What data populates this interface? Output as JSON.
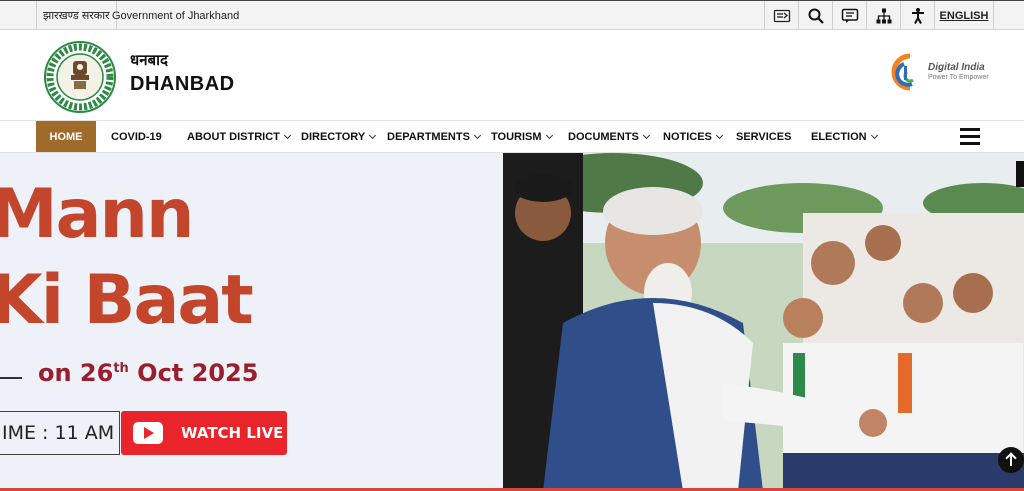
{
  "topbar": {
    "hindi_gov": "झारखण्ड सरकार",
    "english_gov": "Government of Jharkhand",
    "language": "ENGLISH",
    "tools": [
      "skip-to-content-icon",
      "search-icon",
      "screen-reader-icon",
      "sitemap-icon",
      "accessibility-icon"
    ]
  },
  "header": {
    "site_name_hindi": "धनबाद",
    "site_name": "DHANBAD",
    "digital_india_title": "Digital India",
    "digital_india_tagline": "Power To Empower"
  },
  "nav": {
    "items": [
      {
        "label": "HOME",
        "dropdown": false
      },
      {
        "label": "COVID-19",
        "dropdown": false
      },
      {
        "label": "ABOUT DISTRICT",
        "dropdown": true
      },
      {
        "label": "DIRECTORY",
        "dropdown": true
      },
      {
        "label": "DEPARTMENTS",
        "dropdown": true
      },
      {
        "label": "TOURISM",
        "dropdown": true
      },
      {
        "label": "DOCUMENTS",
        "dropdown": true
      },
      {
        "label": "NOTICES",
        "dropdown": true
      },
      {
        "label": "SERVICES",
        "dropdown": false
      },
      {
        "label": "ELECTION",
        "dropdown": true
      }
    ]
  },
  "hero": {
    "line1": "Mann",
    "line2": "Ki Baat",
    "date_prefix": "on 26",
    "date_sup": "th",
    "date_suffix": " Oct 2025",
    "time": "IME : 11 AM",
    "watch_label": "WATCH LIVE"
  },
  "colors": {
    "nav_active": "#a06a2a",
    "headline": "#c3452b",
    "date": "#9a1e2e",
    "watch_button": "#e9242b"
  }
}
